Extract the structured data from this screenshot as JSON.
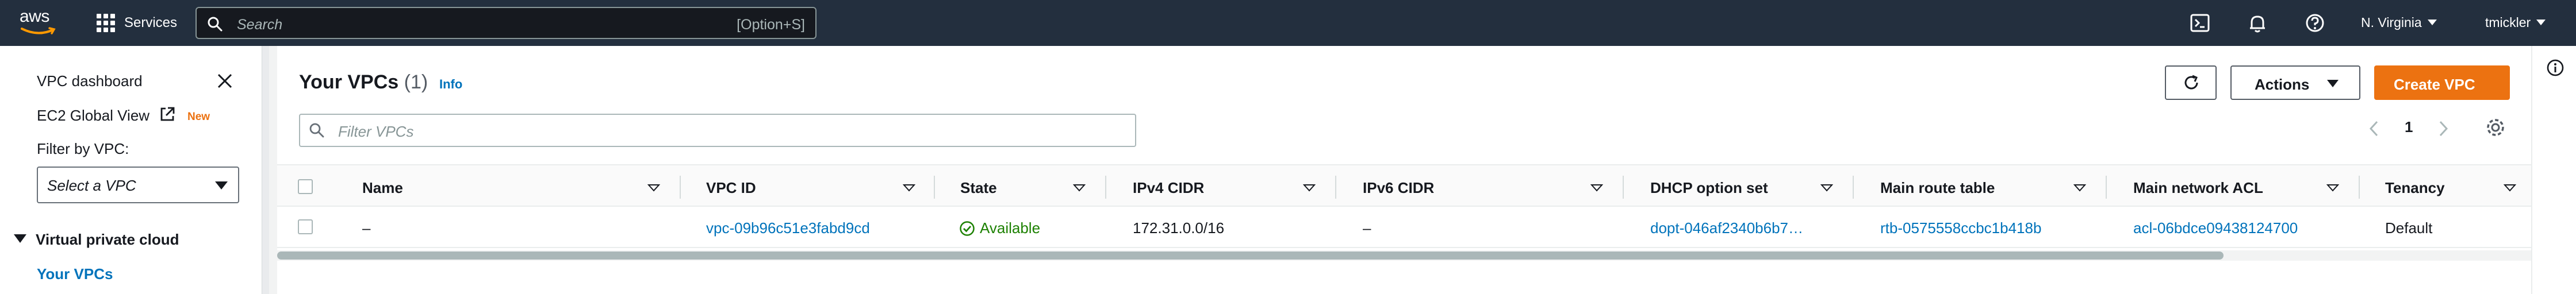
{
  "topnav": {
    "logo": "aws",
    "services": "Services",
    "search_placeholder": "Search",
    "search_shortcut": "[Option+S]",
    "icons": [
      "cloudshell-icon",
      "bell-icon",
      "help-icon"
    ],
    "region": "N. Virginia",
    "user": "tmickler"
  },
  "sidebar": {
    "dashboard": "VPC dashboard",
    "ec2_global_view": "EC2 Global View",
    "new_badge": "New",
    "filter_label": "Filter by VPC:",
    "select_placeholder": "Select a VPC",
    "section": "Virtual private cloud",
    "current": "Your VPCs"
  },
  "main": {
    "title": "Your VPCs",
    "count": "(1)",
    "info": "Info",
    "actions": "Actions",
    "create": "Create VPC",
    "filter_placeholder": "Filter VPCs",
    "page": "1",
    "columns": [
      "Name",
      "VPC ID",
      "State",
      "IPv4 CIDR",
      "IPv6 CIDR",
      "DHCP option set",
      "Main route table",
      "Main network ACL",
      "Tenancy"
    ],
    "row": {
      "name": "–",
      "vpc_id": "vpc-09b96c51e3fabd9cd",
      "state": "Available",
      "ipv4": "172.31.0.0/16",
      "ipv6": "–",
      "dhcp": "dopt-046af2340b6b7…",
      "route_table": "rtb-0575558ccbc1b418b",
      "acl": "acl-06bdce09438124700",
      "tenancy": "Default"
    }
  },
  "colors": {
    "nav_bg": "#232f3e",
    "link": "#0073bb",
    "primary": "#ec7211",
    "success": "#1d8102"
  }
}
